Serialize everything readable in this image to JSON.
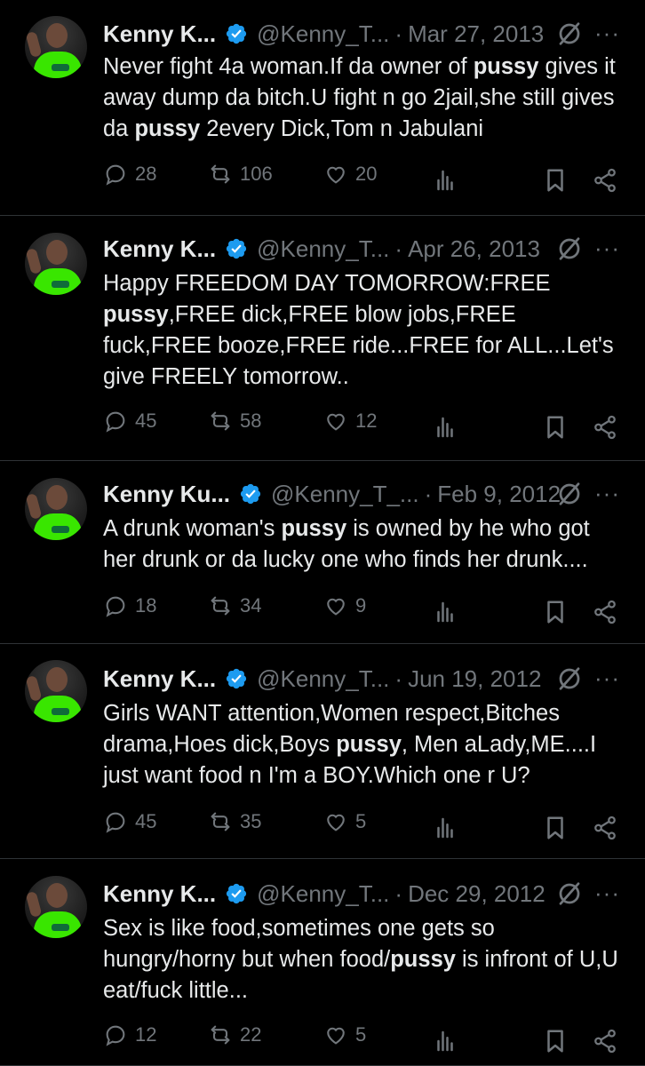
{
  "tweets": [
    {
      "name": "Kenny K...",
      "handle": "@Kenny_T...",
      "date": "Mar 27, 2013",
      "text_parts": [
        {
          "t": "Never fight 4a woman.If da owner of ",
          "b": false
        },
        {
          "t": "pussy",
          "b": true
        },
        {
          "t": " gives it away dump da bitch.U fight n go 2jail,she still gives da ",
          "b": false
        },
        {
          "t": "pussy",
          "b": true
        },
        {
          "t": " 2every Dick,Tom n Jabulani",
          "b": false
        }
      ],
      "replies": "28",
      "reposts": "106",
      "likes": "20"
    },
    {
      "name": "Kenny K...",
      "handle": "@Kenny_T...",
      "date": "Apr 26, 2013",
      "text_parts": [
        {
          "t": "Happy FREEDOM DAY TOMORROW:FREE ",
          "b": false
        },
        {
          "t": "pussy",
          "b": true
        },
        {
          "t": ",FREE dick,FREE blow jobs,FREE fuck,FREE booze,FREE ride...FREE for ALL...Let's give FREELY tomorrow..",
          "b": false
        }
      ],
      "replies": "45",
      "reposts": "58",
      "likes": "12"
    },
    {
      "name": "Kenny Ku...",
      "handle": "@Kenny_T_...",
      "date": "Feb 9, 2012",
      "text_parts": [
        {
          "t": "A drunk woman's ",
          "b": false
        },
        {
          "t": "pussy",
          "b": true
        },
        {
          "t": " is owned by he who got her drunk or da lucky one who finds her drunk....",
          "b": false
        }
      ],
      "replies": "18",
      "reposts": "34",
      "likes": "9"
    },
    {
      "name": "Kenny K...",
      "handle": "@Kenny_T...",
      "date": "Jun 19, 2012",
      "text_parts": [
        {
          "t": "Girls WANT attention,Women respect,Bitches drama,Hoes dick,Boys ",
          "b": false
        },
        {
          "t": "pussy",
          "b": true
        },
        {
          "t": ", Men aLady,ME....I just want food n I'm a BOY.Which one r U?",
          "b": false
        }
      ],
      "replies": "45",
      "reposts": "35",
      "likes": "5"
    },
    {
      "name": "Kenny K...",
      "handle": "@Kenny_T...",
      "date": "Dec 29, 2012",
      "text_parts": [
        {
          "t": "Sex is like food,sometimes one gets so hungry/horny but when food/",
          "b": false
        },
        {
          "t": "pussy",
          "b": true
        },
        {
          "t": " is infront of U,U eat/fuck little...",
          "b": false
        }
      ],
      "replies": "12",
      "reposts": "22",
      "likes": "5"
    }
  ],
  "colors": {
    "background": "#000000",
    "text": "#e7e9ea",
    "muted": "#71767b",
    "verified": "#1d9bf0",
    "divider": "#2f3336"
  },
  "icons": [
    "verified-badge-icon",
    "grok-icon",
    "more-icon",
    "reply-icon",
    "repost-icon",
    "like-icon",
    "views-icon",
    "bookmark-icon",
    "share-icon"
  ]
}
